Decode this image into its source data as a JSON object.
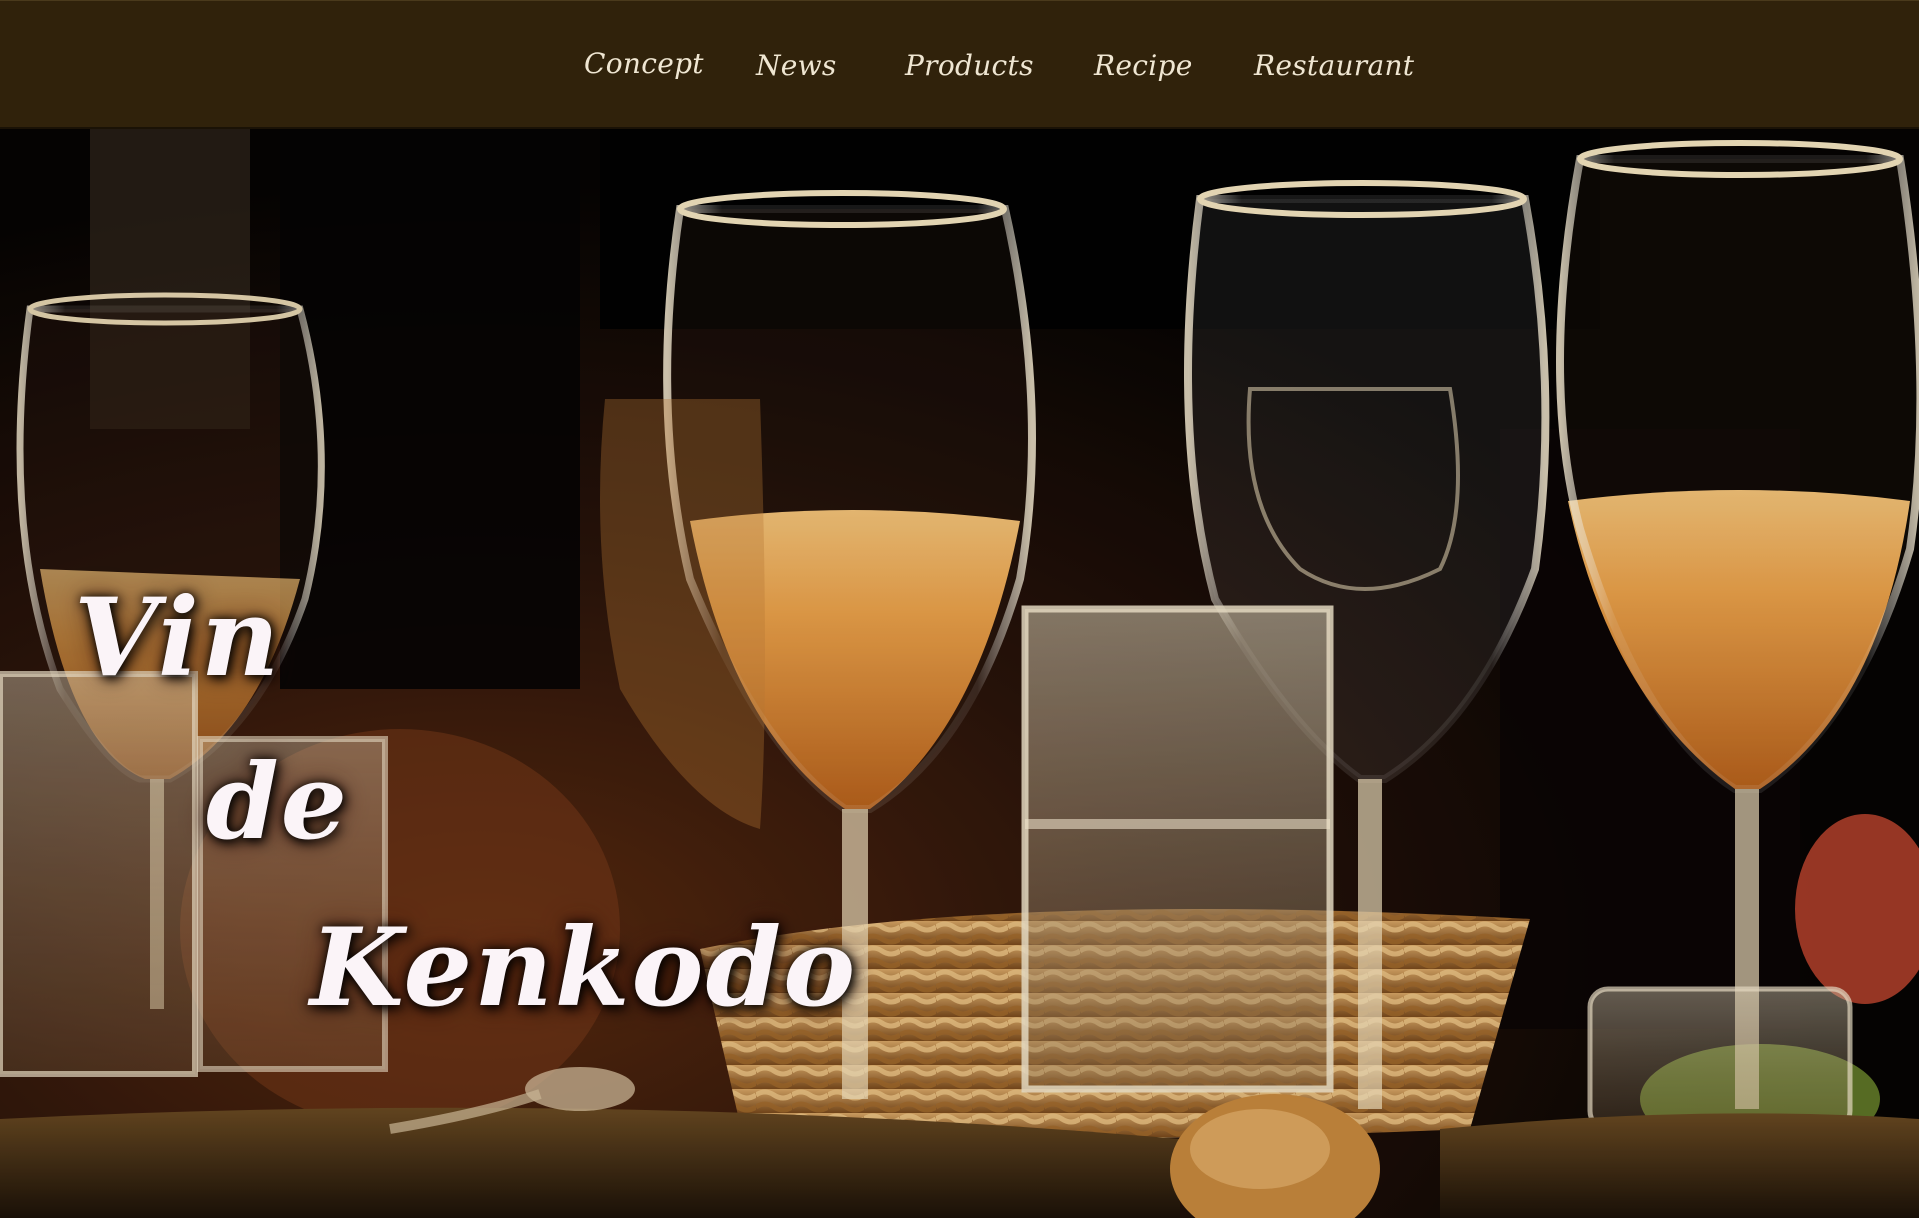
{
  "nav": {
    "items": [
      {
        "label": "Concept"
      },
      {
        "label": "News"
      },
      {
        "label": "Products"
      },
      {
        "label": "Recipe"
      },
      {
        "label": "Restaurant"
      }
    ]
  },
  "hero": {
    "logo_line1": "Vin",
    "logo_line2": "de",
    "logo_line3": "Kenkodo"
  },
  "colors": {
    "navbar_bg": "#30220b",
    "nav_text": "#efe6d2",
    "logo_text": "#fbf4f8",
    "wine": "#e89a40"
  }
}
